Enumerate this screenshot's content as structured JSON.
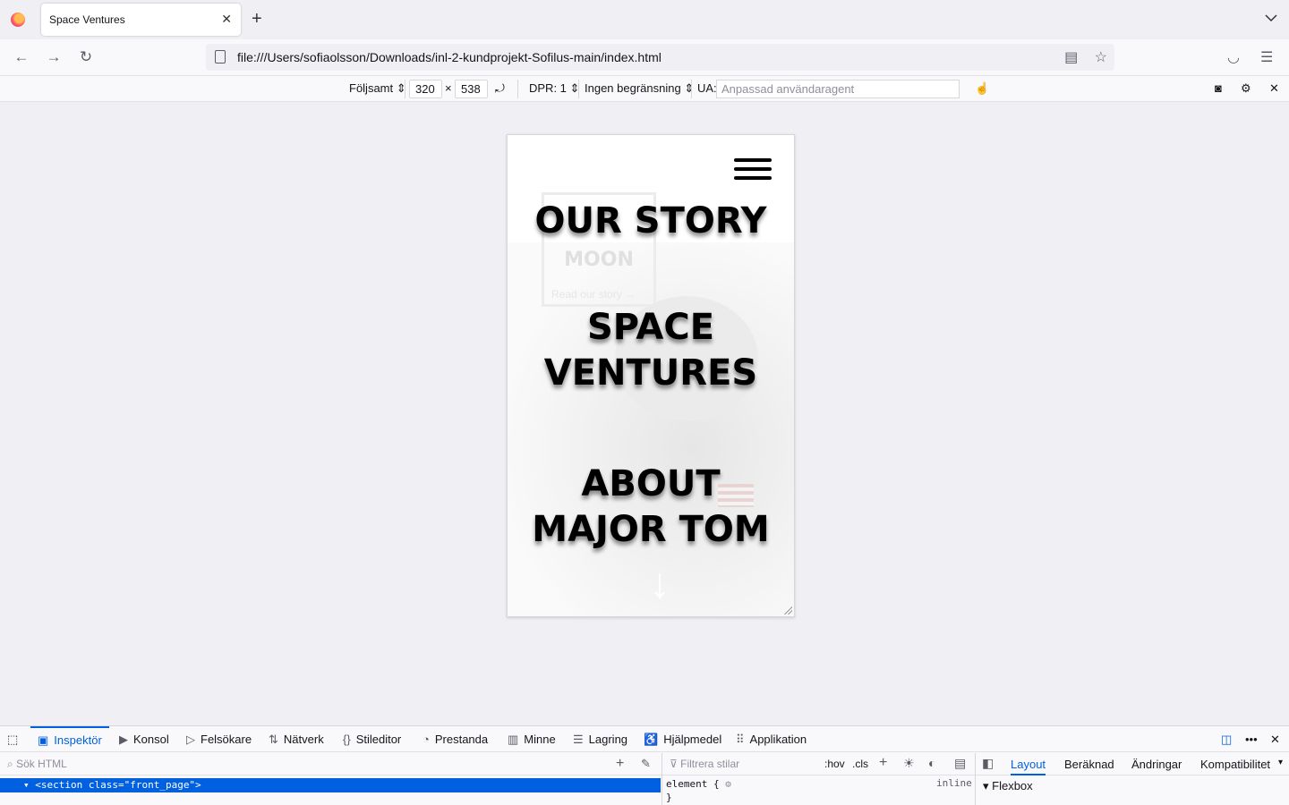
{
  "browser": {
    "tab_title": "Space Ventures",
    "url": "file:///Users/sofiaolsson/Downloads/inl-2-kundprojekt-Sofilus-main/index.html"
  },
  "rdm": {
    "device": "Följsamt",
    "width": "320",
    "times": "×",
    "height": "538",
    "dpr": "DPR: 1",
    "throttling": "Ingen begränsning",
    "ua_label": "UA:",
    "ua_placeholder": "Anpassad användaragent"
  },
  "page": {
    "ghost_moon": "MOON",
    "ghost_link": "Read our story →",
    "menu": [
      {
        "label": "OUR STORY"
      },
      {
        "label": "SPACE VENTURES"
      },
      {
        "label": "ABOUT MAJOR TOM"
      }
    ]
  },
  "devtools": {
    "tabs": [
      {
        "label": "Inspektör",
        "icon": "inspector-icon"
      },
      {
        "label": "Konsol",
        "icon": "console-icon"
      },
      {
        "label": "Felsökare",
        "icon": "debugger-icon"
      },
      {
        "label": "Nätverk",
        "icon": "network-icon"
      },
      {
        "label": "Stileditor",
        "icon": "style-editor-icon"
      },
      {
        "label": "Prestanda",
        "icon": "performance-icon"
      },
      {
        "label": "Minne",
        "icon": "memory-icon"
      },
      {
        "label": "Lagring",
        "icon": "storage-icon"
      },
      {
        "label": "Hjälpmedel",
        "icon": "accessibility-icon"
      },
      {
        "label": "Applikation",
        "icon": "application-icon"
      }
    ],
    "search_html": "Sök HTML",
    "filter_styles": "Filtrera stilar",
    "hov": ":hov",
    "cls": ".cls",
    "selected_node": "<section class=\"front_page\">",
    "rule": "element {",
    "rule_end": "}",
    "inline": "inline",
    "right_tabs": [
      "Layout",
      "Beräknad",
      "Ändringar",
      "Kompatibilitet"
    ],
    "flexbox": "Flexbox"
  }
}
